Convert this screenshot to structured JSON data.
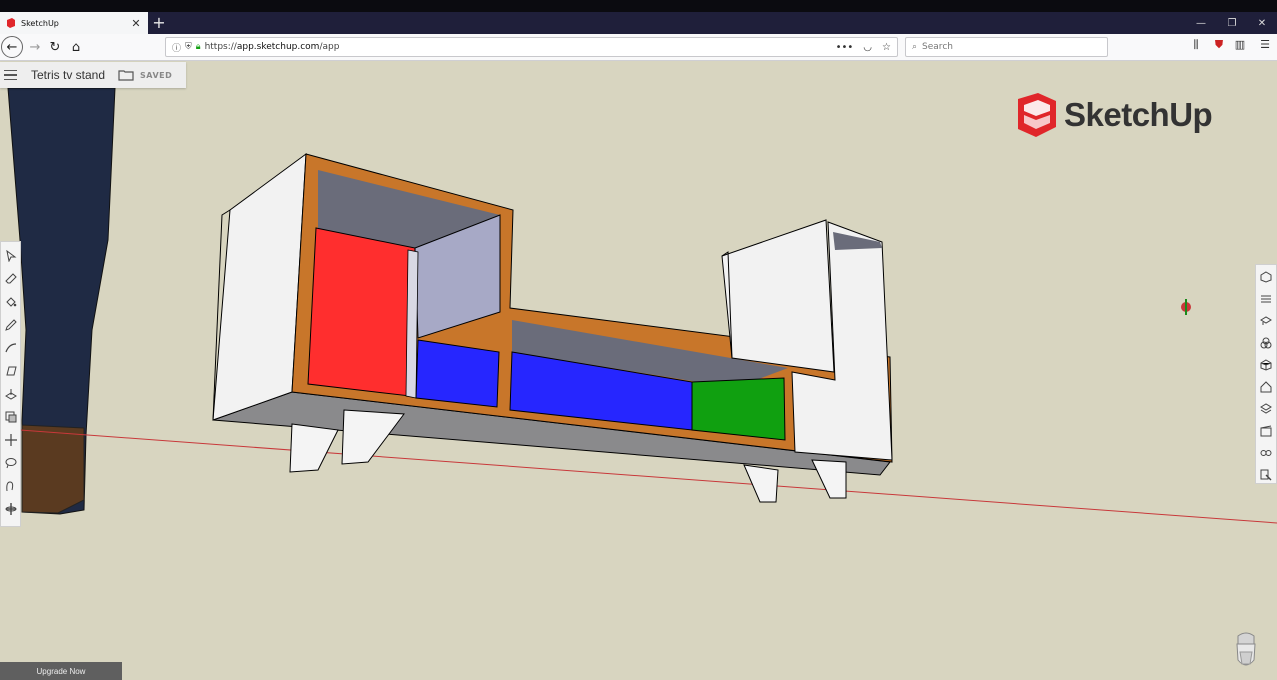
{
  "browser": {
    "tab_title": "SketchUp",
    "tab_close": "✕",
    "new_tab": "+",
    "url_prefix": "https://",
    "url_host": "app.sketchup.com",
    "url_path": "/app",
    "search_placeholder": "Search",
    "menu_dots": "•••"
  },
  "app": {
    "document_title": "Tetris tv stand",
    "save_status": "SAVED",
    "logo_text": "SketchUp",
    "upgrade_label": "Upgrade Now"
  },
  "left_toolbar": [
    "select-icon",
    "eraser-icon",
    "paint-bucket-icon",
    "pencil-icon",
    "arc-icon",
    "rectangle-icon",
    "push-pull-icon",
    "offset-icon",
    "move-icon",
    "lasso-icon",
    "tape-measure-icon",
    "orbit-icon"
  ],
  "right_toolbar": [
    "entity-info-icon",
    "instructor-icon",
    "styles-icon",
    "components-icon",
    "materials-icon",
    "3d-warehouse-icon",
    "layers-icon",
    "scenes-icon",
    "display-icon",
    "outliner-icon"
  ],
  "colors": {
    "canvas_bg": "#d8d5c0",
    "wood": "#c8762a",
    "red_drawer": "#ff2e2e",
    "blue_drawer": "#2626ff",
    "green_drawer": "#10a010",
    "logo_red": "#e0262a"
  }
}
